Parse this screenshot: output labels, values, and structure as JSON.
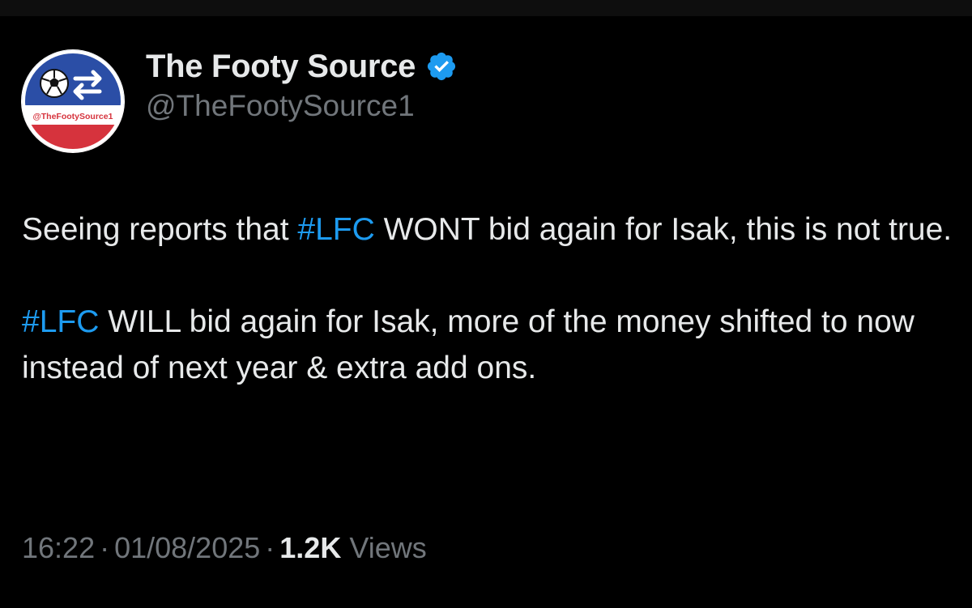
{
  "author": {
    "display_name": "The Footy Source",
    "handle": "@TheFootySource1",
    "verified": true,
    "avatar_text": "@TheFootySource1",
    "verified_color": "#1d9bf0"
  },
  "tweet": {
    "paragraph1": {
      "before": "Seeing reports that ",
      "hashtag": "#LFC",
      "after": " WONT bid again for Isak, this is not true."
    },
    "paragraph2": {
      "hashtag": "#LFC",
      "after": " WILL bid again for Isak, more of the money shifted to now instead of next year & extra add ons."
    }
  },
  "meta": {
    "time": "16:22",
    "separator": "·",
    "date": "01/08/2025",
    "views_count": "1.2K",
    "views_label": "Views"
  },
  "colors": {
    "background": "#000000",
    "text": "#e7e9ea",
    "muted": "#71767b",
    "link": "#1d9bf0"
  }
}
